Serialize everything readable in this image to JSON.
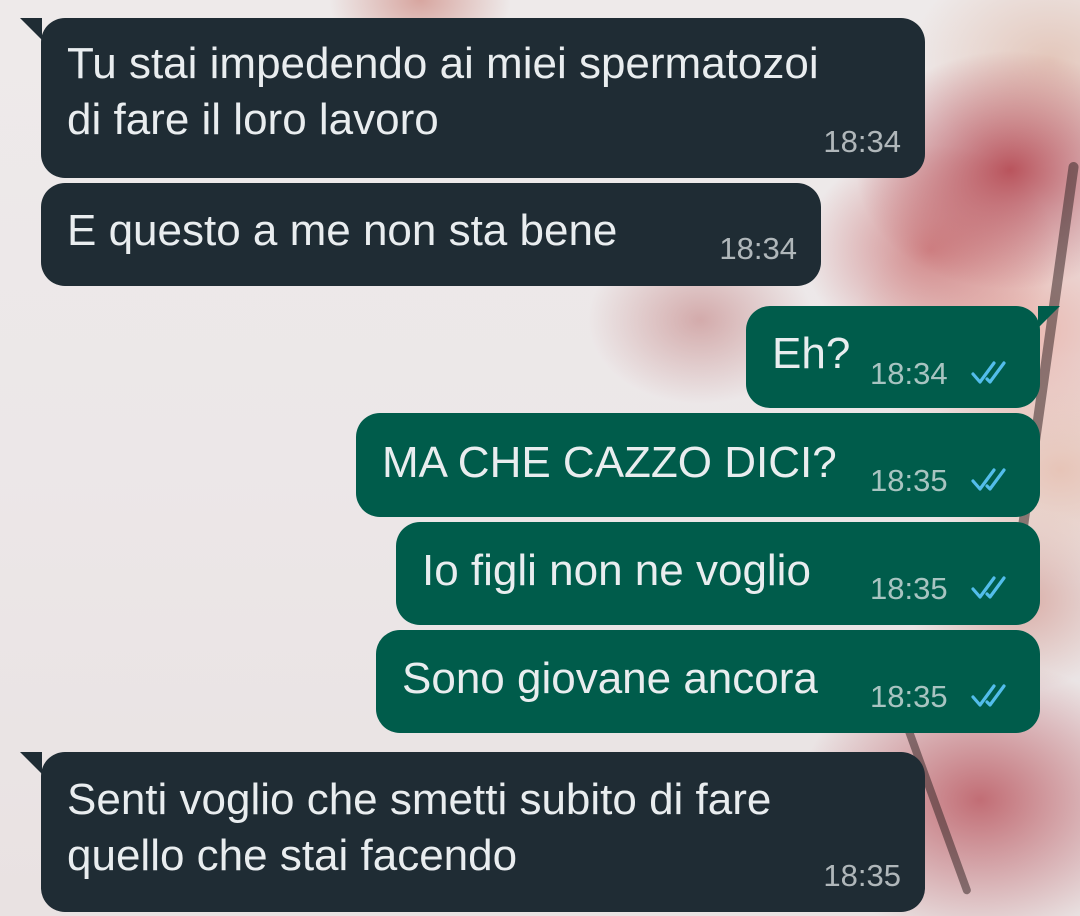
{
  "theme": {
    "incoming_bubble": "#1f2c34",
    "outgoing_bubble": "#005c4b",
    "read_tick_color": "#53bdeb",
    "text_color": "#e9edef"
  },
  "messages": [
    {
      "direction": "incoming",
      "lines": [
        "Tu stai impedendo ai miei spermatozoi",
        "di fare il loro lavoro"
      ],
      "time": "18:34"
    },
    {
      "direction": "incoming",
      "lines": [
        "E questo a me non sta bene"
      ],
      "time": "18:34"
    },
    {
      "direction": "outgoing",
      "lines": [
        "Eh?"
      ],
      "time": "18:34",
      "status": "read",
      "status_icon": "double-check-icon"
    },
    {
      "direction": "outgoing",
      "lines": [
        "MA CHE CAZZO DICI?"
      ],
      "time": "18:35",
      "status": "read",
      "status_icon": "double-check-icon"
    },
    {
      "direction": "outgoing",
      "lines": [
        "Io figli non ne voglio"
      ],
      "time": "18:35",
      "status": "read",
      "status_icon": "double-check-icon"
    },
    {
      "direction": "outgoing",
      "lines": [
        "Sono giovane ancora"
      ],
      "time": "18:35",
      "status": "read",
      "status_icon": "double-check-icon"
    },
    {
      "direction": "incoming",
      "lines": [
        "Senti voglio che smetti subito di fare",
        "quello che stai facendo"
      ],
      "time": "18:35"
    }
  ]
}
